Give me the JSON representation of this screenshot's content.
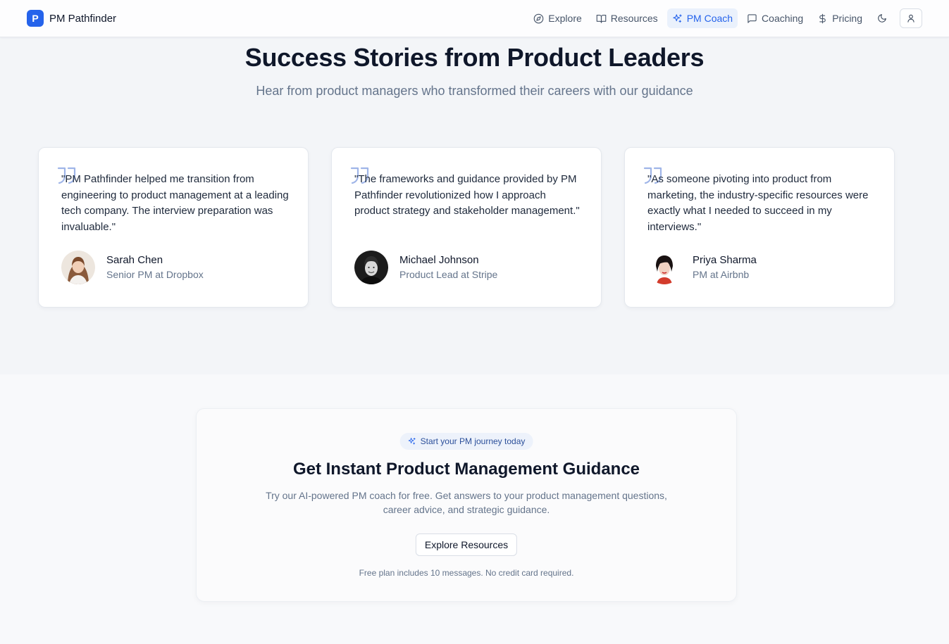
{
  "header": {
    "logo_letter": "P",
    "brand": "PM Pathfinder",
    "nav": [
      {
        "label": "Explore",
        "icon": "compass-icon"
      },
      {
        "label": "Resources",
        "icon": "book-open-icon"
      },
      {
        "label": "PM Coach",
        "icon": "sparkles-icon",
        "active": true
      },
      {
        "label": "Coaching",
        "icon": "message-square-icon"
      },
      {
        "label": "Pricing",
        "icon": "dollar-sign-icon"
      }
    ],
    "theme_icon": "moon-icon",
    "user_icon": "user-icon"
  },
  "stories": {
    "title": "Success Stories from Product Leaders",
    "subtitle": "Hear from product managers who transformed their careers with our guidance",
    "testimonials": [
      {
        "quote": "\"PM Pathfinder helped me transition from engineering to product management at a leading tech company. The interview preparation was invaluable.\"",
        "name": "Sarah Chen",
        "role": "Senior PM at Dropbox"
      },
      {
        "quote": "\"The frameworks and guidance provided by PM Pathfinder revolutionized how I approach product strategy and stakeholder management.\"",
        "name": "Michael Johnson",
        "role": "Product Lead at Stripe"
      },
      {
        "quote": "\"As someone pivoting into product from marketing, the industry-specific resources were exactly what I needed to succeed in my interviews.\"",
        "name": "Priya Sharma",
        "role": "PM at Airbnb"
      }
    ]
  },
  "cta": {
    "badge": "Start your PM journey today",
    "title": "Get Instant Product Management Guidance",
    "description": "Try our AI-powered PM coach for free. Get answers to your product management questions, career advice, and strategic guidance.",
    "button": "Explore Resources",
    "note": "Free plan includes 10 messages. No credit card required."
  },
  "colors": {
    "accent": "#2563eb",
    "active_nav_bg": "#eaf1fc",
    "quote_icon": "#9fb5e8"
  }
}
